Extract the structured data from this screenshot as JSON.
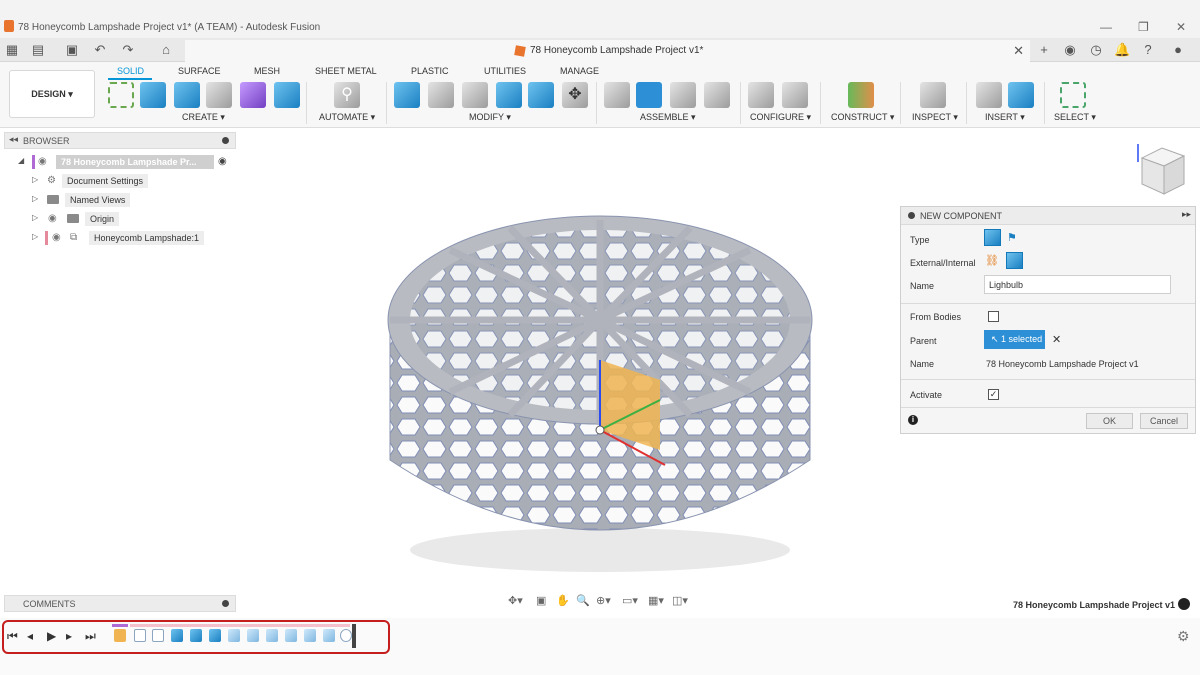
{
  "window": {
    "title": "78 Honeycomb Lampshade Project v1* (A TEAM) - Autodesk Fusion"
  },
  "tab": {
    "document_name": "78 Honeycomb Lampshade Project v1*"
  },
  "ribbon": {
    "workspace": "DESIGN",
    "tabs": [
      "SOLID",
      "SURFACE",
      "MESH",
      "SHEET METAL",
      "PLASTIC",
      "UTILITIES",
      "MANAGE"
    ],
    "active_tab": "SOLID",
    "groups": [
      "CREATE",
      "AUTOMATE",
      "MODIFY",
      "ASSEMBLE",
      "CONFIGURE",
      "CONSTRUCT",
      "INSPECT",
      "INSERT",
      "SELECT"
    ]
  },
  "browser": {
    "title": "BROWSER",
    "root": "78 Honeycomb Lampshade Pr...",
    "items": [
      "Document Settings",
      "Named Views",
      "Origin",
      "Honeycomb Lampshade:1"
    ]
  },
  "dialog": {
    "title": "NEW COMPONENT",
    "type_label": "Type",
    "ext_label": "External/Internal",
    "name_label": "Name",
    "name_value": "Lighbulb",
    "from_bodies_label": "From Bodies",
    "from_bodies_checked": false,
    "parent_label": "Parent",
    "parent_value": "1 selected",
    "name2_label": "Name",
    "name2_value": "78 Honeycomb Lampshade Project v1",
    "activate_label": "Activate",
    "activate_checked": true,
    "ok": "OK",
    "cancel": "Cancel"
  },
  "comments": {
    "title": "COMMENTS"
  },
  "status": {
    "document_name": "78 Honeycomb Lampshade Project v1"
  },
  "colors": {
    "accent": "#0696d7",
    "highlight_border": "#c41e1e",
    "selected_button": "#2d8fd5"
  }
}
